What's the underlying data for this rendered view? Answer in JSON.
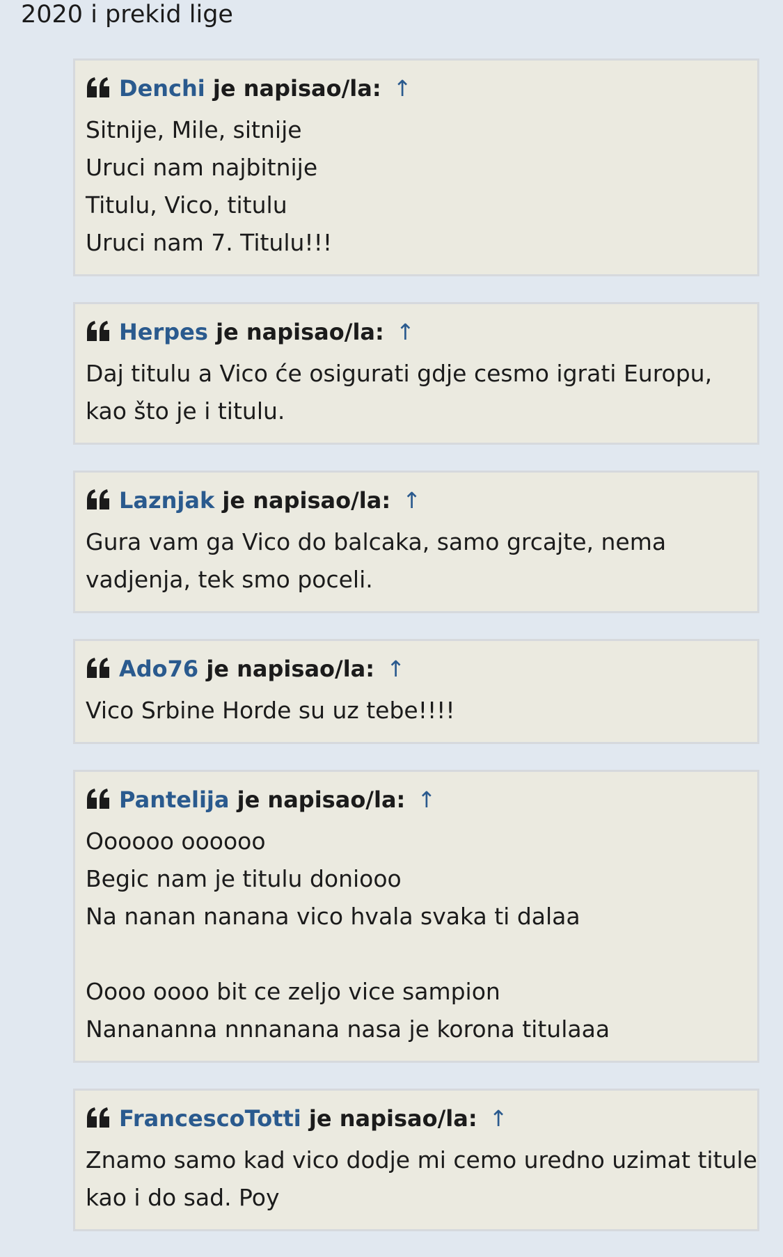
{
  "post": {
    "intro_text": "2020 i prekid lige"
  },
  "quotes": [
    {
      "author": "Denchi",
      "wrote_label": "je napisao/la:",
      "arrow": "↑",
      "lines": [
        "Sitnije, Mile, sitnije",
        "Uruci nam najbitnije",
        "Titulu, Vico, titulu",
        "Uruci nam 7. Titulu!!!"
      ]
    },
    {
      "author": "Herpes",
      "wrote_label": "je napisao/la:",
      "arrow": "↑",
      "lines": [
        "Daj titulu a Vico će osigurati gdje cesmo igrati Europu,",
        "kao što je i titulu."
      ]
    },
    {
      "author": "Laznjak",
      "wrote_label": "je napisao/la:",
      "arrow": "↑",
      "lines": [
        "Gura vam ga Vico do balcaka, samo grcajte, nema",
        "vadjenja, tek smo poceli."
      ]
    },
    {
      "author": "Ado76",
      "wrote_label": "je napisao/la:",
      "arrow": "↑",
      "lines": [
        "Vico Srbine Horde su uz tebe!!!!"
      ]
    },
    {
      "author": "Pantelija",
      "wrote_label": "je napisao/la:",
      "arrow": "↑",
      "lines": [
        "Oooooo oooooo",
        "Begic nam je titulu doniooo",
        "Na nanan nanana vico hvala svaka ti dalaa",
        "",
        "Oooo oooo bit ce zeljo vice sampion",
        "Nanananna nnnanana nasa je korona titulaaa"
      ]
    },
    {
      "author": "FrancescoTotti",
      "wrote_label": "je napisao/la:",
      "arrow": "↑",
      "lines": [
        "Znamo samo kad vico dodje mi cemo uredno uzimat titule",
        "kao i do sad. Poy"
      ]
    }
  ],
  "icons": {
    "quote_icon": "quote-left-icon",
    "link_color": "#2a5a8e",
    "quote_bg": "#ebeae0",
    "page_bg": "#e1e8f0"
  }
}
